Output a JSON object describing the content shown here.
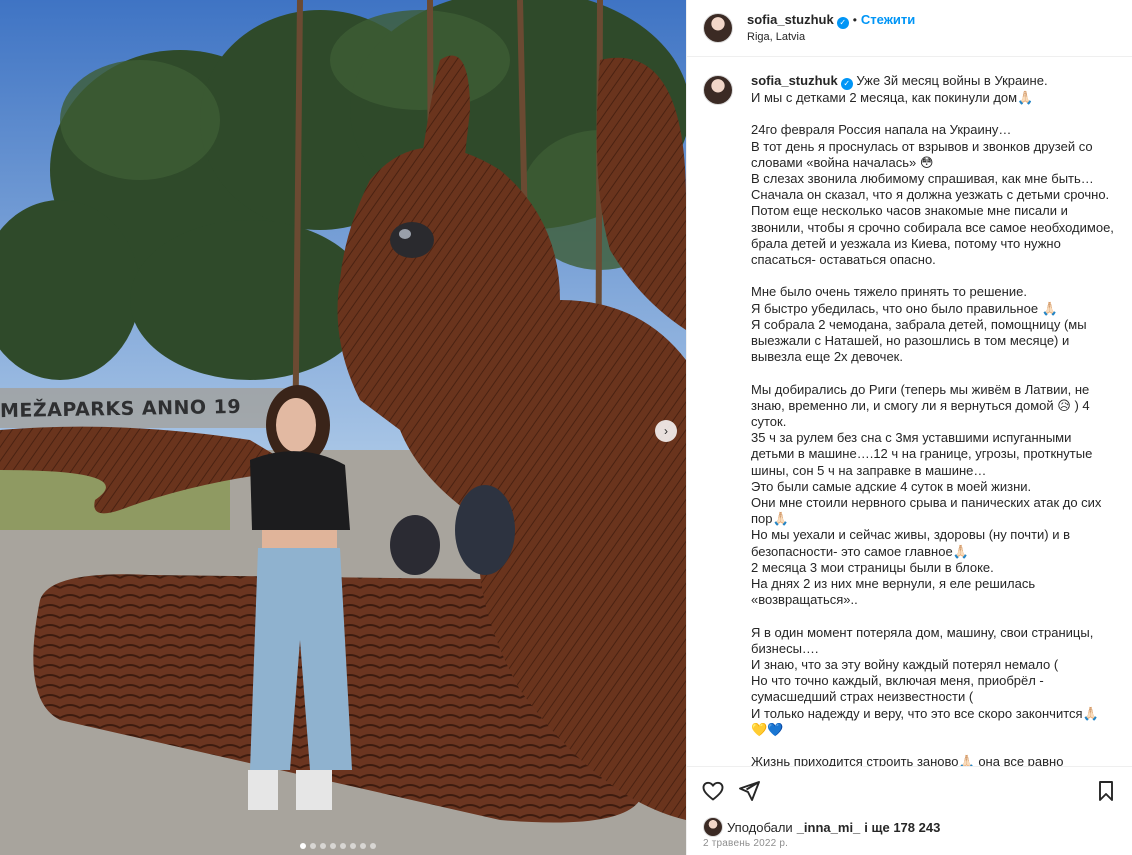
{
  "post": {
    "photo_sign_text": "MEŽAPARKS ANNO 19",
    "carousel": {
      "count": 8,
      "active": 0
    },
    "next_label": "›"
  },
  "header": {
    "username": "sofia_stuzhuk",
    "verified_mark": "✓",
    "dot": "•",
    "follow_label": "Стежити",
    "location": "Riga, Latvia"
  },
  "caption": {
    "username": "sofia_stuzhuk",
    "paragraphs": [
      "Уже 3й месяц войны в Украине.\nИ мы с детками 2 месяца, как покинули дом🙏🏻",
      "24го февраля Россия напала на Украину…\nВ тот день я проснулась от взрывов и звонков друзей со словами «война началась» 😳\nВ слезах звонила любимому спрашивая, как мне быть…\nСначала он сказал, что я должна уезжать с детьми срочно.\nПотом еще несколько часов знакомые мне писали и звонили, чтобы я срочно собирала все самое необходимое, брала детей и уезжала из Киева, потому что нужно спасаться- оставаться опасно.",
      "Мне было очень тяжело принять то решение.\nЯ быстро убедилась, что оно было правильное 🙏🏻\nЯ собрала 2 чемодана, забрала детей, помощницу (мы выезжали с Наташей, но разошлись в том месяце) и вывезла еще 2х девочек.",
      "Мы добирались до Риги (теперь мы живём в Латвии, не знаю, временно ли, и смогу ли я вернуться домой 😥 ) 4 суток.\n35 ч за рулем без сна с 3мя уставшими испуганными детьми в машине….12 ч на границе, угрозы, проткнутые шины, сон 5 ч на заправке в машине…\nЭто были самые адские 4 суток в моей жизни.\nОни мне стоили нервного срыва и панических атак до сих пор🙏🏻\nНо мы уехали и сейчас живы, здоровы (ну почти) и в безопасности- это самое главное🙏🏻\n2 месяца 3 мои страницы были в блоке.\nНа днях 2 из них мне вернули, я еле решилась «возвращаться»..",
      "Я в один момент потеряла дом, машину, свои страницы, бизнесы….\nИ знаю, что за эту войну каждый потерял немало (\nНо что точно каждый, включая меня, приобрёл - сумасшедший страх неизвестности (\nИ только надежду и веру, что это все скоро закончится🙏🏻 💛💙",
      "Жизнь приходится строить заново🙏🏻 она все равно продолжается🙏🏻"
    ]
  },
  "likes": {
    "prefix": "Уподобали",
    "user": "_inna_mi_",
    "suffix": "і ще 178 243"
  },
  "date": "2 травень 2022 р.",
  "icons": {
    "like": "heart-icon",
    "share": "send-icon",
    "save": "bookmark-icon"
  }
}
